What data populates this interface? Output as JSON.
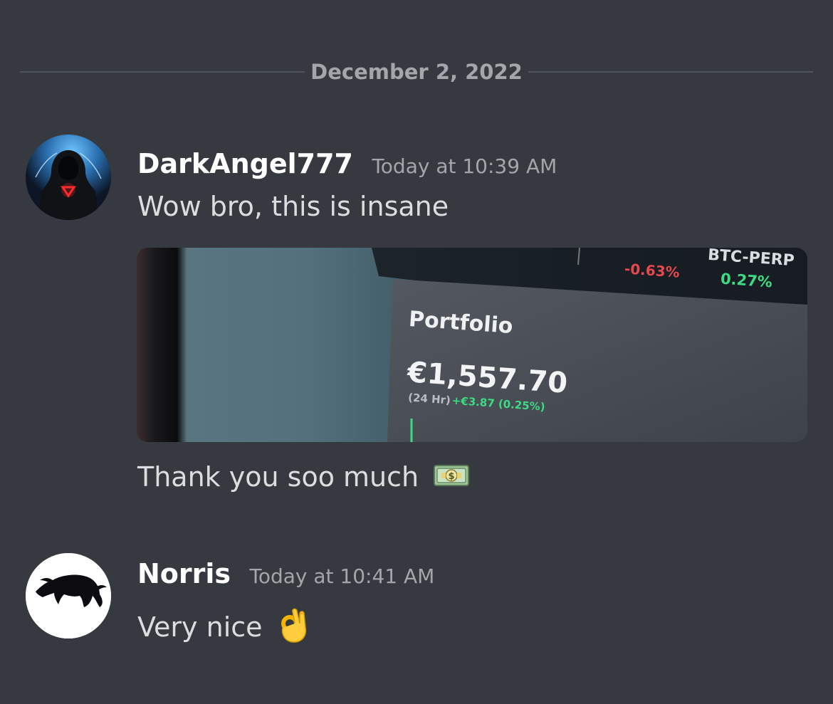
{
  "date_divider": "December 2, 2022",
  "messages": [
    {
      "username": "DarkAngel777",
      "timestamp": "Today at 10:39 AM",
      "lines": [
        "Wow bro, this is insane",
        "Thank you soo much"
      ],
      "attachment": {
        "ticker_left": "-0.63%",
        "ticker_right_name": "BTC-PERP",
        "ticker_right_value": "0.27%",
        "portfolio_label": "Portfolio",
        "portfolio_value": "€1,557.70",
        "change_period": "(24 Hr)",
        "change_value": "+€3.87 (0.25%)"
      },
      "emoji_after_line2": "money-with-wings-icon"
    },
    {
      "username": "Norris",
      "timestamp": "Today at 10:41 AM",
      "lines": [
        "Very nice"
      ],
      "emoji_after_line1": "ok-hand-icon"
    }
  ],
  "colors": {
    "background": "#36393f",
    "username": "#ffffff",
    "text": "#dcddde",
    "muted": "#a3a6aa",
    "divider": "#4f545c",
    "positive": "#3ddc84",
    "negative": "#e5484d"
  }
}
